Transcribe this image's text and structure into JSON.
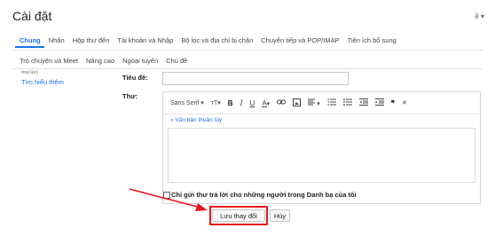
{
  "title": "Cài đặt",
  "language_indicator": "ê",
  "tabs_row1": [
    "Chung",
    "Nhãn",
    "Hộp thư đến",
    "Tài khoản và Nhập",
    "Bộ lọc và địa chỉ bị chặn",
    "Chuyển tiếp và POP/IMAP",
    "Tiện ích bổ sung"
  ],
  "tabs_row2": [
    "Trò chuyện và Meet",
    "Nâng cao",
    "Ngoại tuyến",
    "Chủ đề"
  ],
  "cut_text": "mọi lúc)",
  "learn_more": "Tìm hiểu thêm",
  "subject_label": "Tiêu đề:",
  "body_label": "Thư:",
  "toolbar": {
    "font": "Sans Serif",
    "font_caret": "▾",
    "size": "тT",
    "bold": "B",
    "italic": "I",
    "underline": "U",
    "color": "A",
    "quote": "❞",
    "clear": "✕"
  },
  "plain_text_link": "« Văn bản thuần túy",
  "checkbox_label": "Chỉ gửi thư trả lời cho những người trong Danh bạ của tôi",
  "save_button": "Lưu thay đổi",
  "cancel_button": "Hủy",
  "colors": {
    "accent": "#1a73e8",
    "annotation": "#e8141c"
  }
}
